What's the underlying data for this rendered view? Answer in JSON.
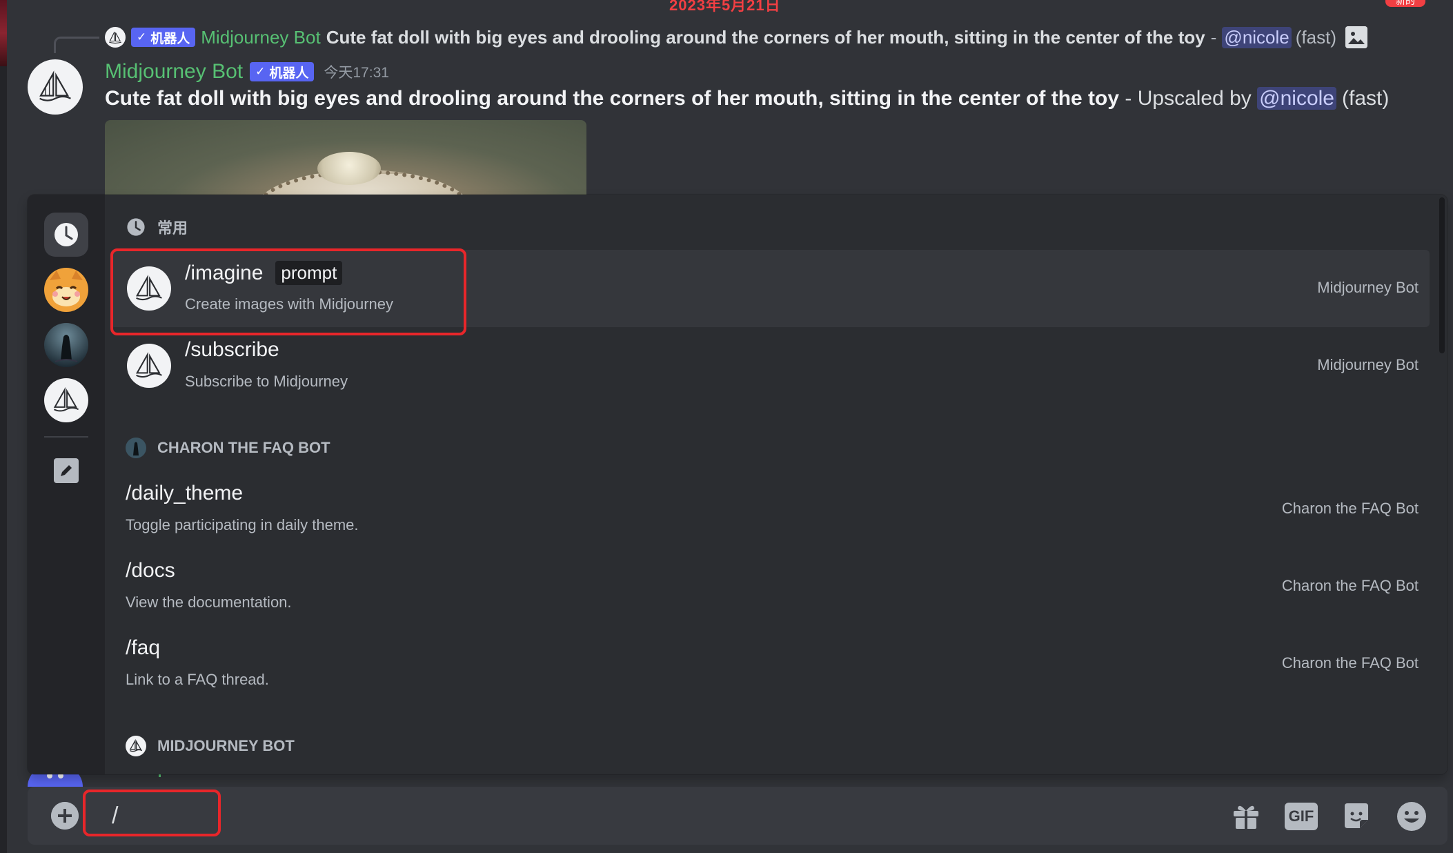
{
  "header": {
    "date_divider": "2023年5月21日",
    "new_badge": "新的"
  },
  "reply": {
    "bot_badge": "机器人",
    "author": "Midjourney Bot",
    "text": "Cute fat doll with big eyes and drooling around the corners of her mouth, sitting in the center of the toy",
    "dash": "-",
    "mention": "@nicole",
    "tail": "(fast)",
    "image_icon": "image-icon"
  },
  "message": {
    "author": "Midjourney Bot",
    "bot_badge": "机器人",
    "time": "今天17:31",
    "prompt": "Cute fat doll with big eyes and drooling around the corners of her mouth, sitting in the center of the toy",
    "suffix": " - Upscaled by ",
    "mention": "@nicole",
    "speed": "(fast)"
  },
  "popup": {
    "rail": [
      {
        "name": "recent",
        "icon": "clock-icon",
        "active": true
      },
      {
        "name": "server-emoji",
        "icon": "cat-face-icon",
        "active": false
      },
      {
        "name": "charon",
        "icon": "charon-avatar",
        "active": false
      },
      {
        "name": "midjourney",
        "icon": "sailboat-icon",
        "active": false
      },
      {
        "name": "edit",
        "icon": "pencil-icon",
        "active": false
      }
    ],
    "sections": {
      "frequent": "常用",
      "charon": "CHARON THE FAQ BOT",
      "midjourney": "MIDJOURNEY BOT"
    },
    "commands": [
      {
        "name": "/imagine",
        "option": "prompt",
        "description": "Create images with Midjourney",
        "source": "Midjourney Bot"
      },
      {
        "name": "/subscribe",
        "option": "",
        "description": "Subscribe to Midjourney",
        "source": "Midjourney Bot"
      },
      {
        "name": "/daily_theme",
        "option": "",
        "description": "Toggle participating in daily theme.",
        "source": "Charon the FAQ Bot"
      },
      {
        "name": "/docs",
        "option": "",
        "description": "View the documentation.",
        "source": "Charon the FAQ Bot"
      },
      {
        "name": "/faq",
        "option": "",
        "description": "Link to a FAQ thread.",
        "source": "Charon the FAQ Bot"
      }
    ]
  },
  "composer": {
    "value": "/",
    "icons": [
      "gift-icon",
      "gif-icon",
      "sticker-icon",
      "emoji-icon"
    ],
    "gif_label": "GIF"
  },
  "colors": {
    "background": "#313338",
    "popup": "#2b2d31",
    "accent": "#5865f2",
    "bot_name": "#57c073",
    "highlight": "#e8262a"
  }
}
